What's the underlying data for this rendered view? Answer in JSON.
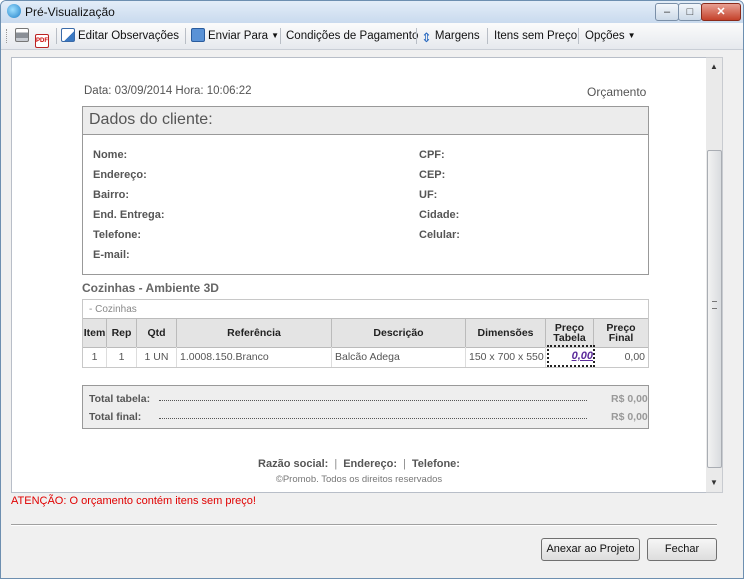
{
  "window": {
    "title": "Pré-Visualização",
    "min_glyph": "–",
    "max_glyph": "□",
    "close_glyph": "✕"
  },
  "toolbar": {
    "pdf_icon_text": "PDF",
    "edit_notes": "Editar Observações",
    "send_to": "Enviar Para",
    "payment_terms": "Condições de Pagamento",
    "margins": "Margens",
    "items_without_price": "Itens sem Preço",
    "options": "Opções"
  },
  "preview": {
    "date_line": "Data: 03/09/2014   Hora: 10:06:22",
    "doc_type": "Orçamento",
    "client": {
      "title": "Dados do cliente:",
      "left_fields": [
        "Nome:",
        "Endereço:",
        "Bairro:",
        "End. Entrega:",
        "Telefone:",
        "E-mail:"
      ],
      "right_fields": [
        "CPF:",
        "CEP:",
        "UF:",
        "Cidade:",
        "Celular:"
      ]
    },
    "section_title": "Cozinhas - Ambiente 3D",
    "subsection": "- Cozinhas",
    "table": {
      "headers": [
        "Item",
        "Rep",
        "Qtd",
        "Referência",
        "Descrição",
        "Dimensões",
        "Preço Tabela",
        "Preço Final"
      ],
      "rows": [
        {
          "item": "1",
          "rep": "1",
          "qtd": "1 UN",
          "ref": "1.0008.150.Branco",
          "desc": "Balcão Adega",
          "dim": "150 x 700 x 550",
          "price_table": "0,00",
          "price_final": "0,00"
        }
      ]
    },
    "totals": {
      "table_label": "Total tabela:",
      "table_value": "R$ 0,00",
      "final_label": "Total final:",
      "final_value": "R$ 0,00"
    },
    "footer": {
      "company": "Razão social:",
      "address": "Endereço:",
      "phone": "Telefone:",
      "copyright": "©Promob. Todos os direitos reservados"
    }
  },
  "warning": "ATENÇÃO: O orçamento contém itens sem preço!",
  "buttons": {
    "attach": "Anexar ao Projeto",
    "close": "Fechar"
  },
  "scrollbar": {
    "up_glyph": "▲",
    "down_glyph": "▼"
  }
}
